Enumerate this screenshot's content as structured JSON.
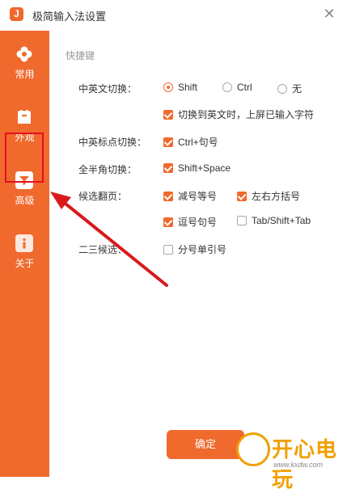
{
  "window": {
    "title": "极简输入法设置",
    "logo_letter": "J"
  },
  "sidebar": {
    "items": [
      {
        "label": "常用",
        "icon": "flower-icon"
      },
      {
        "label": "外观",
        "icon": "shirt-icon"
      },
      {
        "label": "高级",
        "icon": "filter-icon"
      },
      {
        "label": "关于",
        "icon": "info-icon"
      }
    ],
    "active_index": 2
  },
  "main": {
    "section_title": "快捷键",
    "rows": {
      "cn_en_switch": {
        "label": "中英文切换：",
        "options": [
          {
            "label": "Shift",
            "checked": true
          },
          {
            "label": "Ctrl",
            "checked": false
          },
          {
            "label": "无",
            "checked": false
          }
        ],
        "extra": {
          "label": "切换到英文时，上屏已输入字符",
          "checked": true
        }
      },
      "punct_switch": {
        "label": "中英标点切换：",
        "option": {
          "label": "Ctrl+句号",
          "checked": true
        }
      },
      "width_switch": {
        "label": "全半角切换：",
        "option": {
          "label": "Shift+Space",
          "checked": true
        }
      },
      "page_turn": {
        "label": "候选翻页：",
        "options": [
          {
            "label": "减号等号",
            "checked": true
          },
          {
            "label": "左右方括号",
            "checked": true
          },
          {
            "label": "逗号句号",
            "checked": true
          },
          {
            "label": "Tab/Shift+Tab",
            "checked": false
          }
        ]
      },
      "second_third": {
        "label": "二三候选：",
        "option": {
          "label": "分号单引号",
          "checked": false
        }
      }
    },
    "ok_label": "确定"
  },
  "watermark": {
    "text": "开心电玩",
    "url": "www.kxdw.com"
  },
  "colors": {
    "accent": "#f0692d",
    "highlight_box": "#e4101c",
    "arrow": "#d9191c"
  }
}
